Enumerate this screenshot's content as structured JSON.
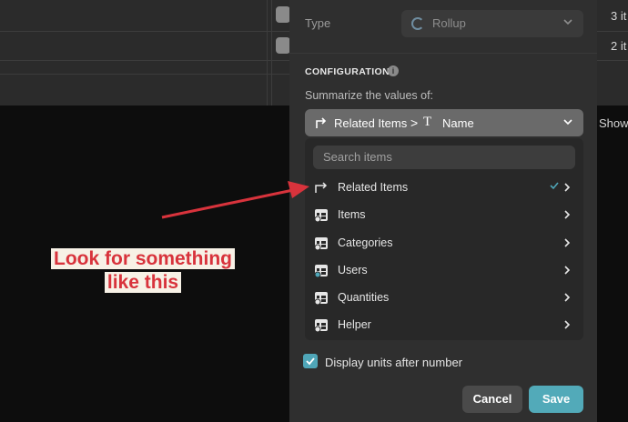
{
  "background": {
    "right_cells": [
      "3 it",
      "2 it"
    ],
    "show_label": "Show"
  },
  "panel": {
    "type_label": "Type",
    "type_value": "Rollup",
    "config_title": "CONFIGURATION",
    "summarize_label": "Summarize the values of:",
    "selected": {
      "part1": "Related Items",
      "separator": ">",
      "part2": "Name"
    },
    "search_placeholder": "Search items",
    "items": [
      {
        "label": "Related Items",
        "icon": "relation-arrow-icon",
        "checked": true
      },
      {
        "label": "Items",
        "icon": "table-add-icon",
        "checked": false
      },
      {
        "label": "Categories",
        "icon": "table-add-icon",
        "checked": false
      },
      {
        "label": "Users",
        "icon": "table-user-icon",
        "checked": false
      },
      {
        "label": "Quantities",
        "icon": "table-add-icon",
        "checked": false
      },
      {
        "label": "Helper",
        "icon": "table-add-icon",
        "checked": false
      }
    ],
    "display_units_label": "Display units after number",
    "display_units_checked": true,
    "cancel_label": "Cancel",
    "save_label": "Save"
  },
  "annotation": {
    "line1": "Look for something",
    "line2": "like this"
  },
  "colors": {
    "accent": "#52aab9",
    "check": "#4fa6b8",
    "annotation": "#d8333c"
  }
}
